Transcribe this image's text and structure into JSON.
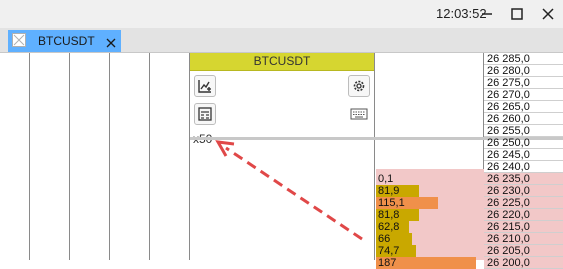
{
  "titlebar": {
    "clock": "12:03:52",
    "minimize_icon": "minimize-icon",
    "maximize_icon": "maximize-icon",
    "close_icon": "close-icon"
  },
  "tabs": [
    {
      "label": "BTCUSDT",
      "icon": "window-icon",
      "close_icon": "close-tab-icon",
      "active": true
    }
  ],
  "cluster": {
    "header": "BTCUSDT",
    "header_color": "#d6d630",
    "scale_label": "x50",
    "icons": [
      "chart-add-icon",
      "settings-gear-icon",
      "calculator-icon",
      "keyboard-icon"
    ]
  },
  "orderbook": {
    "prices": [
      "26 285,0",
      "26 280,0",
      "26 275,0",
      "26 270,0",
      "26 265,0",
      "26 260,0",
      "26 255,0",
      "26 250,0",
      "26 245,0",
      "26 240,0",
      "26 235,0",
      "26 230,0",
      "26 225,0",
      "26 220,0",
      "26 215,0",
      "26 210,0",
      "26 205,0",
      "26 200,0"
    ],
    "ask_volumes": [
      {
        "price": "26 235,0",
        "volume": "0,1",
        "color": "#f2c8c8",
        "fraction": 0.0
      },
      {
        "price": "26 230,0",
        "volume": "81,9",
        "color": "#c9a800",
        "fraction": 0.4
      },
      {
        "price": "26 225,0",
        "volume": "115,1",
        "color": "#f0904a",
        "fraction": 0.57
      },
      {
        "price": "26 220,0",
        "volume": "81,8",
        "color": "#c9a800",
        "fraction": 0.4
      },
      {
        "price": "26 215,0",
        "volume": "62,8",
        "color": "#c9a800",
        "fraction": 0.31
      },
      {
        "price": "26 210,0",
        "volume": "66",
        "color": "#c9a800",
        "fraction": 0.33
      },
      {
        "price": "26 205,0",
        "volume": "74,7",
        "color": "#c9a800",
        "fraction": 0.37
      },
      {
        "price": "26 200,0",
        "volume": "187",
        "color": "#f0904a",
        "fraction": 0.93
      }
    ],
    "ask_background": "#f2c8c8"
  },
  "annotation": {
    "arrow_color": "#e04848"
  }
}
